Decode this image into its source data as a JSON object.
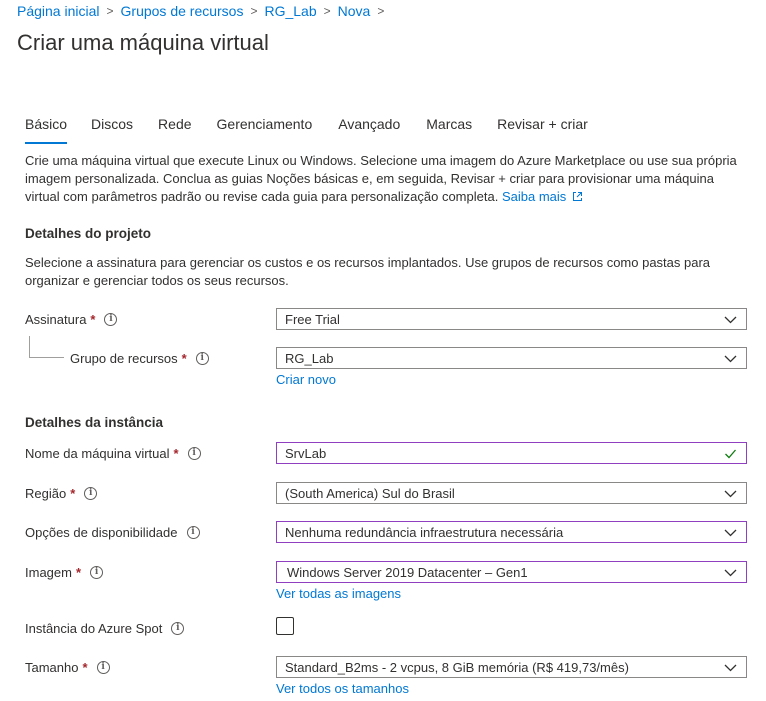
{
  "breadcrumb": [
    "Página inicial",
    "Grupos de recursos",
    "RG_Lab",
    "Nova"
  ],
  "page_title": "Criar uma máquina virtual",
  "tabs": [
    "Básico",
    "Discos",
    "Rede",
    "Gerenciamento",
    "Avançado",
    "Marcas",
    "Revisar + criar"
  ],
  "active_tab": "Básico",
  "intro": {
    "text": "Crie uma máquina virtual que execute Linux ou Windows. Selecione uma imagem do Azure Marketplace ou use sua própria imagem personalizada. Conclua as guias Noções básicas e, em seguida, Revisar + criar para provisionar uma máquina virtual com parâmetros padrão ou revise cada guia para personalização completa.",
    "link": "Saiba mais"
  },
  "project": {
    "title": "Detalhes do projeto",
    "description": "Selecione a assinatura para gerenciar os custos e os recursos implantados. Use grupos de recursos como pastas para organizar e gerenciar todos os seus recursos.",
    "subscription_label": "Assinatura",
    "subscription_value": "Free Trial",
    "resource_group_label": "Grupo de recursos",
    "resource_group_value": "RG_Lab",
    "create_new": "Criar novo"
  },
  "instance": {
    "title": "Detalhes da instância",
    "vm_name_label": "Nome da máquina virtual",
    "vm_name_value": "SrvLab",
    "region_label": "Região",
    "region_value": "(South America) Sul do Brasil",
    "availability_label": "Opções de disponibilidade",
    "availability_value": "Nenhuma redundância infraestrutura necessária",
    "image_label": "Imagem",
    "image_value": "Windows Server 2019 Datacenter – Gen1",
    "image_link": "Ver todas as imagens",
    "spot_label": "Instância do Azure Spot",
    "spot_checked": false,
    "size_label": "Tamanho",
    "size_value": "Standard_B2ms - 2 vcpus, 8 GiB memória (R$ 419,73/mês)",
    "size_link": "Ver todos os tamanhos"
  },
  "required_marker": "*",
  "info_glyph": "i",
  "colors": {
    "link": "#0078d4",
    "required": "#a4262c",
    "focus_border": "#8f3fbf",
    "valid_check": "#107c10",
    "text": "#323130"
  }
}
